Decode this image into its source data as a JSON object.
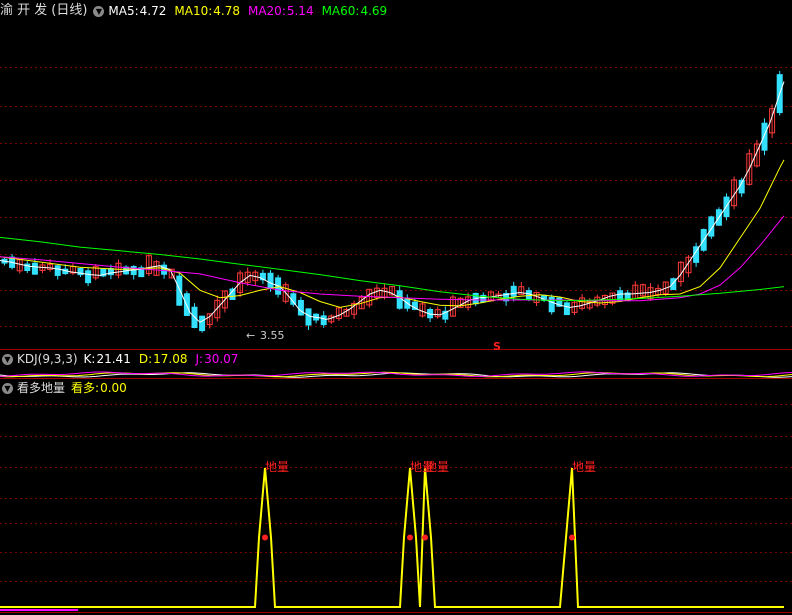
{
  "price_panel": {
    "stock_name": "渝 开 发",
    "period": "(日线)",
    "ma5_label": "MA5:",
    "ma5_value": "4.72",
    "ma10_label": "MA10:",
    "ma10_value": "4.78",
    "ma20_label": "MA20:",
    "ma20_value": "5.14",
    "ma60_label": "MA60:",
    "ma60_value": "4.69",
    "low_marker": "3.55",
    "signal_mark": "S"
  },
  "kdj_panel": {
    "name": "KDJ(9,3,3)",
    "k_label": "K:",
    "k_value": "21.41",
    "d_label": "D:",
    "d_value": "17.08",
    "j_label": "J:",
    "j_value": "30.07"
  },
  "ind_panel": {
    "name": "看多地量",
    "line_label": "看多:",
    "line_value": "0.00",
    "peak_label": "地量"
  },
  "colors": {
    "up": "#ff3b3b",
    "down": "#33e0ff",
    "ma5": "#ffffff",
    "ma10": "#ffff00",
    "ma20": "#ff00ff",
    "ma60": "#00ff00",
    "grid": "#7a0000",
    "indicator": "#ffff00"
  },
  "chart_data": [
    {
      "type": "line",
      "title": "",
      "series": [
        {
          "name": "MA5",
          "x": [
            0,
            10,
            20,
            30,
            40,
            50,
            60,
            70,
            80,
            90,
            100,
            110,
            120,
            130,
            140,
            150,
            160,
            162,
            170,
            180,
            190,
            200,
            210,
            220,
            230,
            240,
            250,
            260,
            270,
            280,
            290,
            300,
            310,
            320,
            326,
            330,
            340,
            350,
            360,
            370,
            380,
            390,
            400,
            410,
            420,
            430,
            440,
            450,
            460,
            470,
            480,
            490,
            500,
            510,
            520,
            530,
            540,
            550,
            560,
            570,
            580,
            590,
            600,
            610,
            620,
            630,
            640,
            650,
            660,
            670,
            680,
            690,
            700,
            710,
            720,
            730,
            740,
            750,
            760,
            770,
            780,
            784
          ],
          "values": [
            4.45,
            4.43,
            4.4,
            4.37,
            4.36,
            4.35,
            4.33,
            4.3,
            4.28,
            4.26,
            4.25,
            4.28,
            4.3,
            4.32,
            4.33,
            4.36,
            4.38,
            4.36,
            4.33,
            4.05,
            3.75,
            3.62,
            3.7,
            3.85,
            4.0,
            4.15,
            4.25,
            4.22,
            4.15,
            4.1,
            3.95,
            3.78,
            3.7,
            3.68,
            3.66,
            3.67,
            3.72,
            3.8,
            3.9,
            4.0,
            4.05,
            4.02,
            3.95,
            3.85,
            3.78,
            3.73,
            3.72,
            3.78,
            3.85,
            3.92,
            3.95,
            3.96,
            3.98,
            4.0,
            4.02,
            4.0,
            3.95,
            3.9,
            3.85,
            3.82,
            3.84,
            3.88,
            3.92,
            3.97,
            4.0,
            4.0,
            4.01,
            4.02,
            4.05,
            4.1,
            4.25,
            4.45,
            4.65,
            4.85,
            5.05,
            5.25,
            5.45,
            5.7,
            6.0,
            6.3,
            6.7,
            6.85
          ]
        },
        {
          "name": "MA10",
          "x": [
            0,
            40,
            80,
            120,
            160,
            180,
            200,
            220,
            240,
            260,
            280,
            300,
            320,
            340,
            360,
            380,
            400,
            420,
            440,
            460,
            480,
            500,
            520,
            540,
            560,
            580,
            600,
            620,
            640,
            660,
            680,
            700,
            720,
            740,
            760,
            780,
            784
          ],
          "values": [
            4.5,
            4.43,
            4.36,
            4.33,
            4.35,
            4.28,
            4.05,
            3.95,
            3.98,
            4.05,
            4.1,
            4.02,
            3.9,
            3.82,
            3.87,
            3.95,
            3.96,
            3.9,
            3.85,
            3.84,
            3.88,
            3.93,
            3.97,
            3.99,
            3.96,
            3.9,
            3.88,
            3.9,
            3.95,
            3.99,
            4.0,
            4.1,
            4.35,
            4.75,
            5.15,
            5.7,
            5.8
          ]
        },
        {
          "name": "MA20",
          "x": [
            0,
            40,
            80,
            120,
            160,
            200,
            240,
            280,
            320,
            360,
            400,
            440,
            480,
            520,
            560,
            600,
            640,
            680,
            700,
            720,
            740,
            760,
            784
          ],
          "values": [
            4.5,
            4.46,
            4.41,
            4.36,
            4.32,
            4.27,
            4.15,
            4.05,
            4.0,
            3.97,
            3.95,
            3.93,
            3.92,
            3.92,
            3.92,
            3.91,
            3.91,
            3.95,
            4.0,
            4.12,
            4.35,
            4.65,
            5.05
          ]
        },
        {
          "name": "MA60",
          "x": [
            0,
            40,
            80,
            120,
            160,
            200,
            240,
            280,
            320,
            360,
            400,
            440,
            480,
            520,
            560,
            600,
            640,
            680,
            720,
            760,
            784
          ],
          "values": [
            4.76,
            4.7,
            4.63,
            4.58,
            4.53,
            4.47,
            4.4,
            4.33,
            4.26,
            4.18,
            4.11,
            4.03,
            3.97,
            3.93,
            3.91,
            3.92,
            3.94,
            3.97,
            4.01,
            4.06,
            4.1
          ]
        }
      ]
    },
    {
      "type": "line",
      "title": "看多地量",
      "series": [
        {
          "name": "看多",
          "x": [
            0,
            255,
            259,
            265,
            271,
            275,
            400,
            404,
            410,
            416,
            420,
            425,
            431,
            435,
            560,
            566,
            572,
            578,
            784
          ],
          "values": [
            0,
            0,
            0.5,
            1,
            0.5,
            0,
            0,
            0.5,
            1,
            0.5,
            0,
            1,
            0.5,
            0,
            0,
            0.5,
            1,
            0,
            0
          ]
        }
      ],
      "annotations": [
        {
          "x": 265,
          "text": "地量"
        },
        {
          "x": 410,
          "text": "地量"
        },
        {
          "x": 425,
          "text": "地量"
        },
        {
          "x": 572,
          "text": "地量"
        }
      ]
    }
  ]
}
